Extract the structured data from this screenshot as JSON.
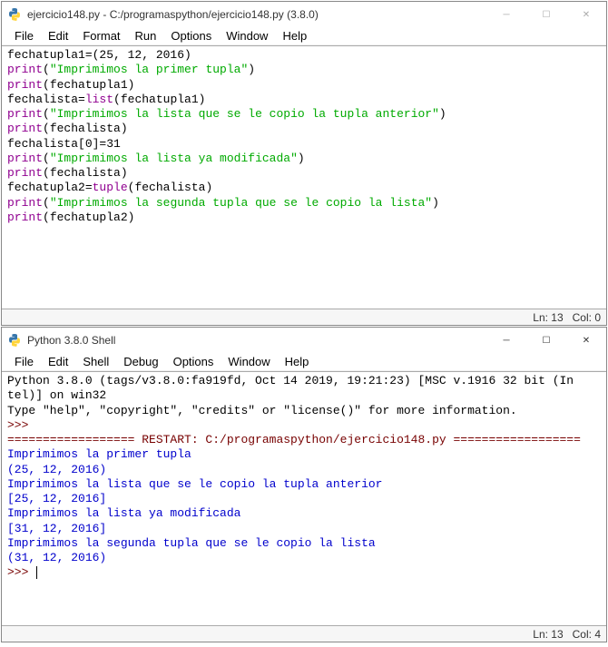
{
  "editor_window": {
    "title": "ejercicio148.py - C:/programaspython/ejercicio148.py (3.8.0)",
    "menu": [
      "File",
      "Edit",
      "Format",
      "Run",
      "Options",
      "Window",
      "Help"
    ],
    "status": {
      "ln": "Ln: 13",
      "col": "Col: 0"
    },
    "code": {
      "l1_a": "fechatupla1=(25, 12, 2016)",
      "l2_p": "print",
      "l2_s": "\"Imprimimos la primer tupla\"",
      "l3_p": "print",
      "l3_a": "(fechatupla1)",
      "l4_a": "fechalista=",
      "l4_b": "list",
      "l4_c": "(fechatupla1)",
      "l5_p": "print",
      "l5_s": "\"Imprimimos la lista que se le copio la tupla anterior\"",
      "l6_p": "print",
      "l6_a": "(fechalista)",
      "l7_a": "fechalista[0]=31",
      "l8_p": "print",
      "l8_s": "\"Imprimimos la lista ya modificada\"",
      "l9_p": "print",
      "l9_a": "(fechalista)",
      "l10_a": "fechatupla2=",
      "l10_b": "tuple",
      "l10_c": "(fechalista)",
      "l11_p": "print",
      "l11_s": "\"Imprimimos la segunda tupla que se le copio la lista\"",
      "l12_p": "print",
      "l12_a": "(fechatupla2)"
    }
  },
  "shell_window": {
    "title": "Python 3.8.0 Shell",
    "menu": [
      "File",
      "Edit",
      "Shell",
      "Debug",
      "Options",
      "Window",
      "Help"
    ],
    "status": {
      "ln": "Ln: 13",
      "col": "Col: 4"
    },
    "banner1": "Python 3.8.0 (tags/v3.8.0:fa919fd, Oct 14 2019, 19:21:23) [MSC v.1916 32 bit (In",
    "banner2": "tel)] on win32",
    "banner3": "Type \"help\", \"copyright\", \"credits\" or \"license()\" for more information.",
    "prompt": ">>>",
    "restart": "================== RESTART: C:/programaspython/ejercicio148.py ==================",
    "out": [
      "Imprimimos la primer tupla",
      "(25, 12, 2016)",
      "Imprimimos la lista que se le copio la tupla anterior",
      "[25, 12, 2016]",
      "Imprimimos la lista ya modificada",
      "[31, 12, 2016]",
      "Imprimimos la segunda tupla que se le copio la lista",
      "(31, 12, 2016)"
    ]
  },
  "win_controls": {
    "min": "─",
    "max": "☐",
    "close": "✕"
  }
}
